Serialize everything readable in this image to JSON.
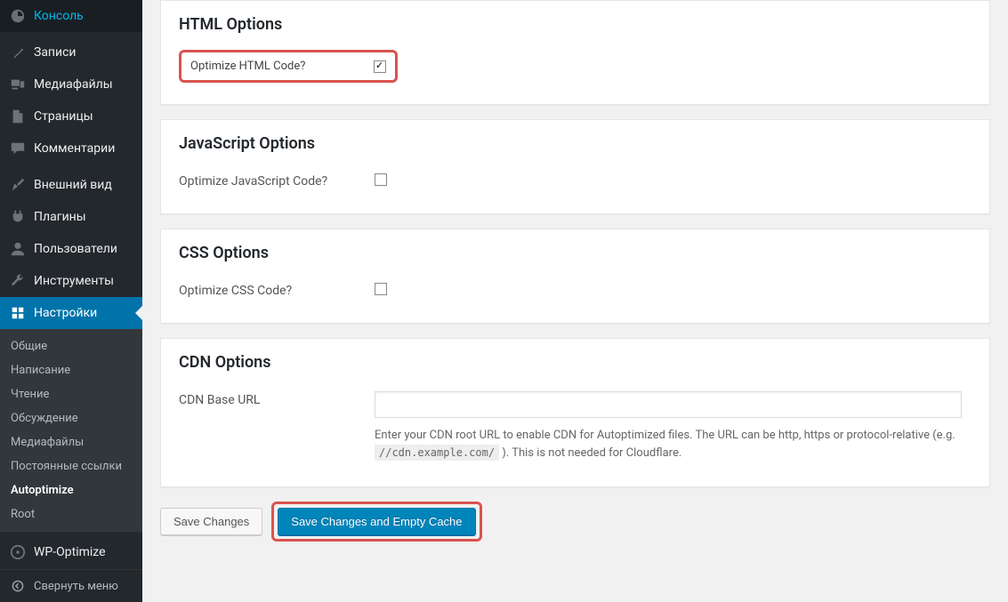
{
  "sidebar": {
    "main_items": [
      {
        "label": "Консоль",
        "icon": "dashboard-icon"
      },
      {
        "label": "Записи",
        "icon": "pin-icon"
      },
      {
        "label": "Медиафайлы",
        "icon": "media-icon"
      },
      {
        "label": "Страницы",
        "icon": "pages-icon"
      },
      {
        "label": "Комментарии",
        "icon": "comments-icon"
      },
      {
        "label": "Внешний вид",
        "icon": "appearance-icon"
      },
      {
        "label": "Плагины",
        "icon": "plugins-icon"
      },
      {
        "label": "Пользователи",
        "icon": "users-icon"
      },
      {
        "label": "Инструменты",
        "icon": "tools-icon"
      },
      {
        "label": "Настройки",
        "icon": "settings-icon"
      }
    ],
    "submenu": [
      "Общие",
      "Написание",
      "Чтение",
      "Обсуждение",
      "Медиафайлы",
      "Постоянные ссылки",
      "Autoptimize",
      "Root"
    ],
    "extra_item": "WP-Optimize",
    "collapse": "Свернуть меню"
  },
  "sections": {
    "html": {
      "title": "HTML Options",
      "optimize_label": "Optimize HTML Code?",
      "optimize_checked": true
    },
    "js": {
      "title": "JavaScript Options",
      "optimize_label": "Optimize JavaScript Code?",
      "optimize_checked": false
    },
    "css": {
      "title": "CSS Options",
      "optimize_label": "Optimize CSS Code?",
      "optimize_checked": false
    },
    "cdn": {
      "title": "CDN Options",
      "url_label": "CDN Base URL",
      "url_value": "",
      "desc_before": "Enter your CDN root URL to enable CDN for Autoptimized files. The URL can be http, https or protocol-relative (e.g. ",
      "desc_code": "//cdn.example.com/",
      "desc_after": " ). This is not needed for Cloudflare."
    }
  },
  "buttons": {
    "save": "Save Changes",
    "save_empty": "Save Changes and Empty Cache"
  }
}
